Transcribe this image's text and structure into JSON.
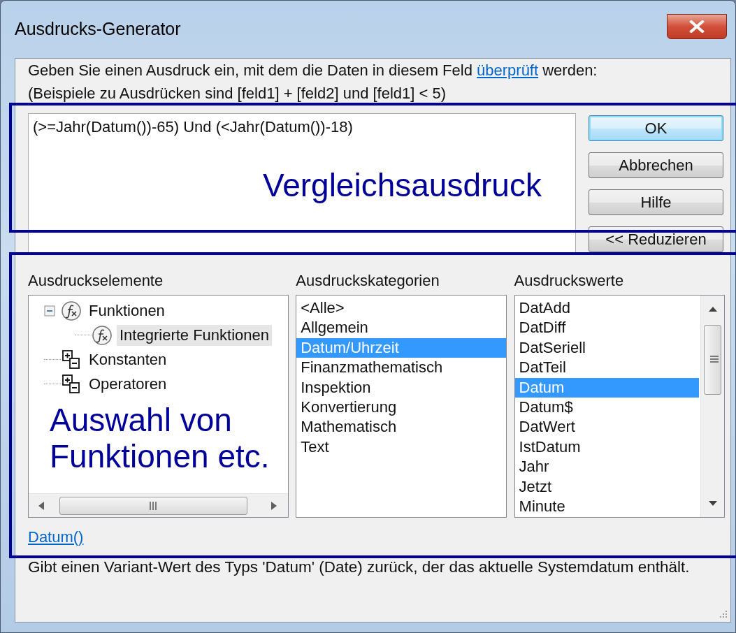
{
  "window": {
    "title": "Ausdrucks-Generator"
  },
  "instructions": {
    "before": "Geben Sie einen Ausdruck ein, mit dem die Daten in diesem Feld ",
    "link": "überprüft",
    "after": " werden:",
    "example": "(Beispiele zu Ausdrücken sind [feld1] + [feld2] und [feld1] < 5)"
  },
  "expression": {
    "value": "(>=Jahr(Datum())-65) Und (<Jahr(Datum())-18)"
  },
  "buttons": [
    {
      "label": "OK",
      "default": true
    },
    {
      "label": "Abbrechen",
      "default": false
    },
    {
      "label": "Hilfe",
      "default": false
    },
    {
      "label": "<< Reduzieren",
      "default": false
    }
  ],
  "elements": {
    "label": "Ausdruckselemente",
    "items": [
      {
        "label": "Funktionen",
        "kind": "function",
        "selected": false,
        "expanded": true,
        "children": [
          {
            "label": "Integrierte Funktionen",
            "kind": "function",
            "selected": true
          }
        ]
      },
      {
        "label": "Konstanten",
        "kind": "group",
        "selected": false
      },
      {
        "label": "Operatoren",
        "kind": "group",
        "selected": false
      }
    ]
  },
  "categories": {
    "label": "Ausdruckskategorien",
    "items": [
      {
        "label": "<Alle>",
        "selected": false
      },
      {
        "label": "Allgemein",
        "selected": false
      },
      {
        "label": "Datum/Uhrzeit",
        "selected": true
      },
      {
        "label": "Finanzmathematisch",
        "selected": false
      },
      {
        "label": "Inspektion",
        "selected": false
      },
      {
        "label": "Konvertierung",
        "selected": false
      },
      {
        "label": "Mathematisch",
        "selected": false
      },
      {
        "label": "Text",
        "selected": false
      }
    ]
  },
  "values": {
    "label": "Ausdruckswerte",
    "items": [
      {
        "label": "DatAdd",
        "selected": false
      },
      {
        "label": "DatDiff",
        "selected": false
      },
      {
        "label": "DatSeriell",
        "selected": false
      },
      {
        "label": "DatTeil",
        "selected": false
      },
      {
        "label": "Datum",
        "selected": true
      },
      {
        "label": "Datum$",
        "selected": false
      },
      {
        "label": "DatWert",
        "selected": false
      },
      {
        "label": "IstDatum",
        "selected": false
      },
      {
        "label": "Jahr",
        "selected": false
      },
      {
        "label": "Jetzt",
        "selected": false
      },
      {
        "label": "Minute",
        "selected": false
      }
    ]
  },
  "function_link": "Datum()",
  "description": "Gibt einen Variant-Wert des Typs 'Datum' (Date) zurück, der das aktuelle Systemdatum enthält.",
  "annotations": [
    {
      "text": "Vergleichsausdruck"
    },
    {
      "text": "Auswahl von Funktionen etc."
    }
  ]
}
